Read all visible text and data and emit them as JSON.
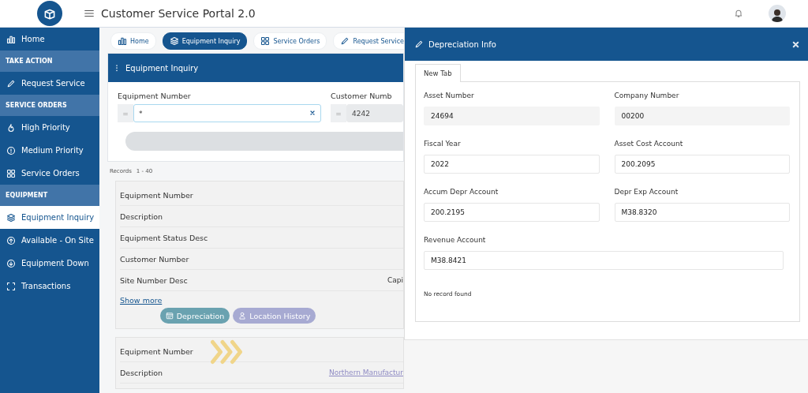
{
  "header": {
    "title": "Customer Service Portal 2.0"
  },
  "sidebar": {
    "items": [
      {
        "kind": "item",
        "label": "Home",
        "selected": false
      },
      {
        "kind": "section",
        "label": "TAKE ACTION"
      },
      {
        "kind": "item",
        "label": "Request Service",
        "selected": false
      },
      {
        "kind": "section",
        "label": "SERVICE ORDERS"
      },
      {
        "kind": "item",
        "label": "High Priority",
        "selected": false
      },
      {
        "kind": "item",
        "label": "Medium Priority",
        "selected": false
      },
      {
        "kind": "item",
        "label": "Service Orders",
        "selected": false
      },
      {
        "kind": "section",
        "label": "EQUIPMENT"
      },
      {
        "kind": "item",
        "label": "Equipment Inquiry",
        "selected": true
      },
      {
        "kind": "item",
        "label": "Available - On Site",
        "selected": false
      },
      {
        "kind": "item",
        "label": "Equipment Down",
        "selected": false
      },
      {
        "kind": "item",
        "label": "Transactions",
        "selected": false
      }
    ]
  },
  "main": {
    "tabs": [
      {
        "label": "Home",
        "selected": false
      },
      {
        "label": "Equipment Inquiry",
        "selected": true
      },
      {
        "label": "Service Orders",
        "selected": false
      },
      {
        "label": "Request Service",
        "selected": false
      }
    ],
    "search_card": {
      "title": "Equipment Inquiry",
      "fields": [
        {
          "label": "Equipment Number",
          "operator": "=",
          "value": "*",
          "disabled": false
        },
        {
          "label": "Customer Numb",
          "operator": "=",
          "value": "4242",
          "disabled": true
        }
      ]
    },
    "records_label": "Records",
    "records_range": "1 - 40",
    "records": [
      {
        "rows": [
          {
            "label": "Equipment Number"
          },
          {
            "label": "Description"
          },
          {
            "label": "Equipment Status Desc"
          },
          {
            "label": "Customer Number"
          },
          {
            "label": "Site Number Desc",
            "value": "Capi"
          }
        ],
        "show_more": "Show more",
        "actions": [
          {
            "kind": "depreciation",
            "label": "Depreciation"
          },
          {
            "kind": "location",
            "label": "Location History"
          }
        ]
      },
      {
        "rows": [
          {
            "label": "Equipment Number"
          },
          {
            "label": "Description",
            "value": "Northern Manufactur"
          }
        ]
      }
    ]
  },
  "panel": {
    "title": "Depreciation Info",
    "tabs": [
      {
        "label": "New Tab",
        "selected": true
      }
    ],
    "fields": [
      {
        "label": "Asset Number",
        "value": "24694",
        "readonly": true
      },
      {
        "label": "Company Number",
        "value": "00200",
        "readonly": true
      },
      {
        "label": "Fiscal Year",
        "value": "2022",
        "readonly": false
      },
      {
        "label": "Asset Cost Account",
        "value": "200.2095",
        "readonly": false
      },
      {
        "label": "Accum Depr Account",
        "value": "200.2195",
        "readonly": false
      },
      {
        "label": "Depr Exp Account",
        "value": "M38.8320",
        "readonly": false
      },
      {
        "label": "Revenue Account",
        "value": "M38.8421",
        "readonly": false
      }
    ],
    "message": "No record found"
  }
}
